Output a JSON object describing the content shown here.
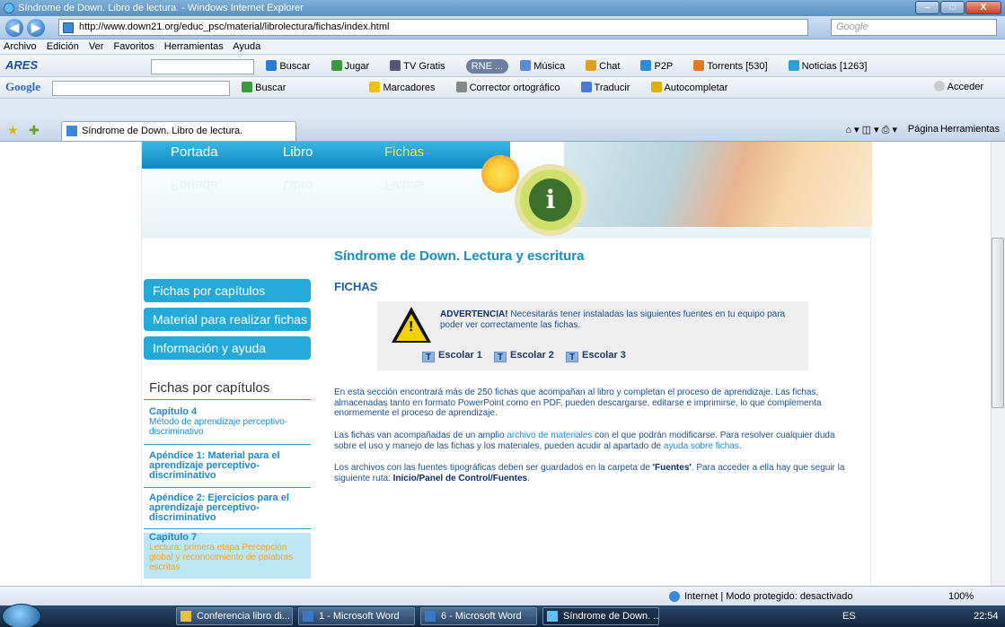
{
  "window": {
    "title": "Síndrome de Down. Libro de lectura. - Windows Internet Explorer"
  },
  "address": {
    "url": "http://www.down21.org/educ_psc/material/librolectura/fichas/index.html",
    "search_placeholder": "Google"
  },
  "menu": [
    "Archivo",
    "Edición",
    "Ver",
    "Favoritos",
    "Herramientas",
    "Ayuda"
  ],
  "toolbar1": [
    "ARES",
    "Buscar",
    "Jugar",
    "TV Gratis",
    "RNE ...",
    "Música",
    "Chat",
    "P2P",
    "Torrents [530]",
    "Noticias [1263]"
  ],
  "toolbar2": [
    "Google",
    "Buscar",
    "Marcadores",
    "Corrector ortográfico",
    "Traducir",
    "Autocompletar",
    "Acceder"
  ],
  "tab": {
    "label": "Síndrome de Down. Libro de lectura.",
    "tools": [
      "Página",
      "Herramientas"
    ]
  },
  "site": {
    "nav": [
      "Portada",
      "Libro",
      "Fichas"
    ],
    "title": "Síndrome de Down. Lectura y escritura",
    "section": "FICHAS",
    "side_buttons": [
      "Fichas por capítulos",
      "Material para realizar fichas",
      "Información y ayuda"
    ],
    "side_heading": "Fichas por capítulos",
    "chapters": [
      {
        "title": "Capítulo 4",
        "desc": "Método de aprendizaje perceptivo-discriminativo"
      },
      {
        "title": "Apéndice 1: Material para el aprendizaje perceptivo-discriminativo",
        "desc": ""
      },
      {
        "title": "Apéndice 2: Ejercicios para el aprendizaje perceptivo-discriminativo",
        "desc": ""
      },
      {
        "title": "Capítulo 7",
        "desc": "Lectura: primera etapa Percepción global y reconocimiento de palabras escritas"
      }
    ],
    "warning": {
      "lead": "ADVERTENCIA!",
      "text": "Necesitarás tener instaladas las siguientes fuentes en tu equipo para poder ver correctamente las fichas."
    },
    "fonts": [
      "Escolar 1",
      "Escolar 2",
      "Escolar 3"
    ],
    "p1": "En esta sección encontrará más de 250 fichas que acompañan al libro y completan el proceso de aprendizaje. Las fichas, almacenadas tanto en formato PowerPoint como en PDF, pueden descargarse, editarse e imprimirse, lo que complementa enormemente el proceso de aprendizaje.",
    "p2a": "Las fichas van acompañadas de un amplio ",
    "p2link1": "archivo de materiales",
    "p2b": " con el que podrán modificarse. Para resolver cualquier duda sobre el uso y manejo de las fichas y los materiales, pueden acudir al apartado de ",
    "p2link2": "ayuda sobre fichas",
    "p2c": ".",
    "p3a": "Los archivos con las fuentes tipográficas deben ser guardados en la carpeta de ",
    "p3b": "'Fuentes'",
    "p3c": ". Para acceder a ella hay que seguir la siguiente ruta: ",
    "p3d": "Inicio/Panel de Control/Fuentes",
    "p3e": "."
  },
  "status": {
    "text": "Internet | Modo protegido: desactivado",
    "zoom": "100%"
  },
  "taskbar": {
    "tasks": [
      "Conferencia libro di...",
      "1 - Microsoft Word",
      "6 - Microsoft Word",
      "Síndrome de Down. ..."
    ],
    "lang": "ES",
    "clock": "22:54"
  }
}
